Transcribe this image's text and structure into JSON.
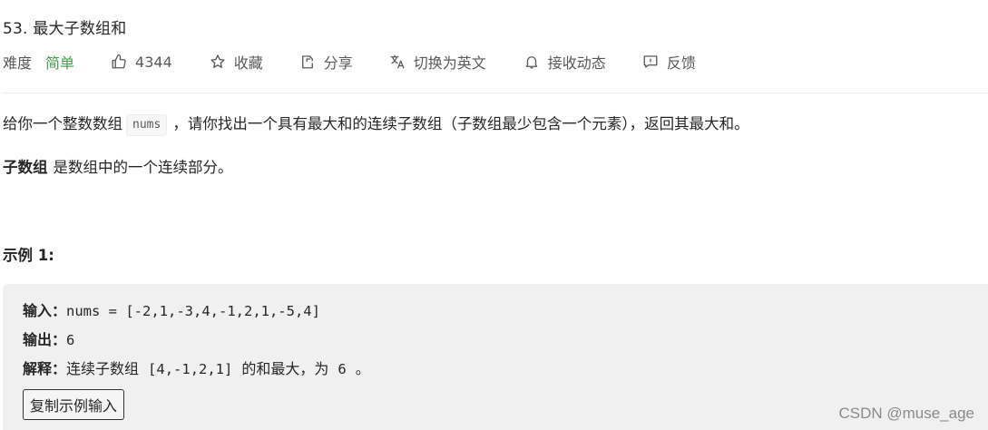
{
  "problem": {
    "title": "53. 最大子数组和",
    "difficulty_label": "难度",
    "difficulty": "简单",
    "likes": "4344",
    "favorite_label": "收藏",
    "share_label": "分享",
    "switch_lang_label": "切换为英文",
    "notify_label": "接收动态",
    "feedback_label": "反馈"
  },
  "description": {
    "p1_before": "给你一个整数数组",
    "p1_code": "nums",
    "p1_after": "，请你找出一个具有最大和的连续子数组（子数组最少包含一个元素），返回其最大和。",
    "p2_bold": "子数组",
    "p2_rest": "是数组中的一个连续部分。"
  },
  "example": {
    "title": "示例 1:",
    "input_label": "输入：",
    "input_value": "nums = [-2,1,-3,4,-1,2,1,-5,4]",
    "output_label": "输出：",
    "output_value": "6",
    "explain_label": "解释：",
    "explain_text1": "连续子数组",
    "explain_code1": "[4,-1,2,1]",
    "explain_text2": "的和最大，为",
    "explain_code2": "6",
    "explain_text3": "。",
    "copy_button": "复制示例输入"
  },
  "watermark": "CSDN @muse_age",
  "colors": {
    "difficulty_easy": "#43a047",
    "example_bg": "#f0f0f0",
    "divider": "#ebebeb"
  },
  "icons": [
    "thumbs-up-icon",
    "star-icon",
    "share-icon",
    "translate-icon",
    "bell-icon",
    "feedback-icon"
  ]
}
